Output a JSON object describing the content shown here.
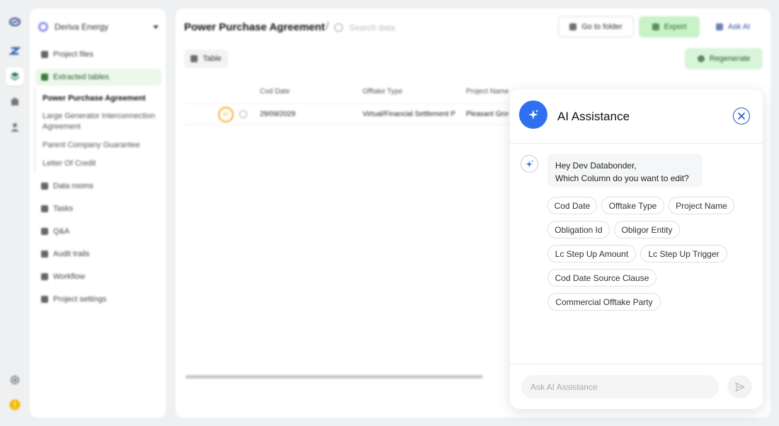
{
  "sidebar": {
    "org_name": "Deriva Energy",
    "items": [
      {
        "label": "Project files"
      },
      {
        "label": "Extracted tables"
      },
      {
        "label": "Data rooms"
      },
      {
        "label": "Tasks"
      },
      {
        "label": "Q&A"
      },
      {
        "label": "Audit trails"
      },
      {
        "label": "Workflow"
      },
      {
        "label": "Project settings"
      }
    ],
    "sub_items": [
      {
        "label": "Power Purchase Agreement"
      },
      {
        "label": "Large Generator Interconnection Agreement"
      },
      {
        "label": "Parent Company Guarantee"
      },
      {
        "label": "Letter Of Credit"
      }
    ]
  },
  "header": {
    "title": "Power Purchase Agreement",
    "separator": "/",
    "search_placeholder": "Search data",
    "go_to_folder": "Go to folder",
    "export": "Export",
    "ask_ai": "Ask AI"
  },
  "toolbar": {
    "table_label": "Table",
    "regenerate": "Regenerate"
  },
  "table": {
    "columns": [
      "Cod Date",
      "Offtake Type",
      "Project Name"
    ],
    "rows": [
      {
        "score": "67",
        "cells": [
          "29/09/2029",
          "Virtual/Financial Settlement P",
          "Pleasant Grov"
        ]
      }
    ]
  },
  "ai_panel": {
    "title": "AI Assistance",
    "greeting_line1": "Hey Dev Databonder,",
    "greeting_line2": "Which Column do you want to edit?",
    "chips": [
      "Cod Date",
      "Offtake Type",
      "Project Name",
      "Obligation Id",
      "Obligor Entity",
      "Lc Step Up Amount",
      "Lc Step Up Trigger",
      "Cod Date Source Clause",
      "Commercial Offtake Party"
    ],
    "input_placeholder": "Ask AI Assistance"
  },
  "colors": {
    "accent_blue": "#2f6ff0",
    "green_light": "#c9f2c9",
    "score_orange": "#f5a623",
    "warning_yellow": "#f5b800"
  },
  "icons": {
    "rail": [
      "brand-logo-icon",
      "z-logo-icon",
      "layers-icon",
      "puzzle-icon",
      "user-icon",
      "gear-icon",
      "alert-icon"
    ],
    "ai_logo": "sparkle-icon",
    "close": "close-icon",
    "send": "send-icon"
  }
}
